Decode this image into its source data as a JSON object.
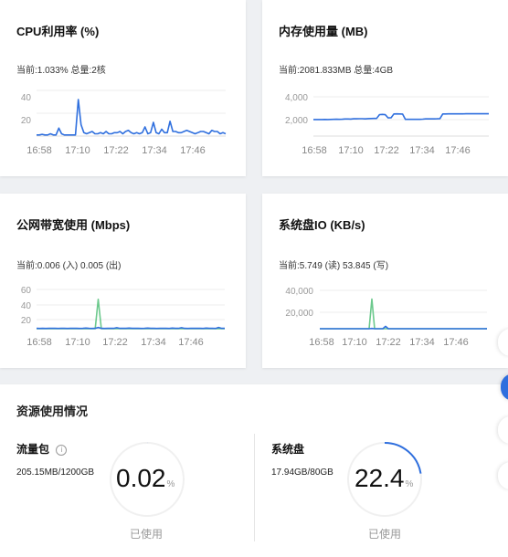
{
  "cpu": {
    "title": "CPU利用率 (%)",
    "subtitle": "当前:1.033% 总量:2核",
    "y_ticks": [
      "40",
      "20"
    ],
    "x_ticks": [
      "16:58",
      "17:10",
      "17:22",
      "17:34",
      "17:46"
    ]
  },
  "mem": {
    "title": "内存使用量 (MB)",
    "subtitle": "当前:2081.833MB 总量:4GB",
    "y_ticks": [
      "4,000",
      "2,000"
    ],
    "x_ticks": [
      "16:58",
      "17:10",
      "17:22",
      "17:34",
      "17:46"
    ]
  },
  "net": {
    "title": "公网带宽使用 (Mbps)",
    "subtitle": "当前:0.006 (入) 0.005 (出)",
    "y_ticks": [
      "60",
      "40",
      "20"
    ],
    "x_ticks": [
      "16:58",
      "17:10",
      "17:22",
      "17:34",
      "17:46"
    ]
  },
  "disk": {
    "title": "系统盘IO (KB/s)",
    "subtitle": "当前:5.749 (读) 53.845 (写)",
    "y_ticks": [
      "40,000",
      "20,000"
    ],
    "x_ticks": [
      "16:58",
      "17:10",
      "17:22",
      "17:34",
      "17:46"
    ]
  },
  "resources": {
    "title": "资源使用情况",
    "traffic": {
      "label": "流量包",
      "amount": "205.15MB/1200GB",
      "percent": "0.02",
      "unit": "%",
      "used_label": "已使用",
      "fraction": 0.0002
    },
    "disk": {
      "label": "系统盘",
      "amount": "17.94GB/80GB",
      "percent": "22.4",
      "unit": "%",
      "used_label": "已使用",
      "fraction": 0.224
    }
  },
  "colors": {
    "blue": "#2f6fde",
    "green": "#6cc98d",
    "ring_gray": "#f0f0f0"
  },
  "icons": {
    "info": "info-circle-icon"
  },
  "chart_data": [
    {
      "type": "line",
      "title": "CPU利用率 (%)",
      "x_ticks": [
        "16:58",
        "17:10",
        "17:22",
        "17:34",
        "17:46"
      ],
      "ylim": [
        0,
        45
      ],
      "series": [
        {
          "color": "#2f6fde",
          "values": [
            1,
            1,
            1.5,
            1,
            1,
            2,
            1,
            1,
            7,
            2,
            1,
            1,
            1,
            1,
            1,
            32,
            10,
            3,
            2,
            3,
            4,
            2,
            2,
            3,
            2,
            4,
            2,
            2,
            3,
            3,
            4,
            2,
            4,
            5,
            3,
            2,
            3,
            2,
            3,
            8,
            2,
            3,
            12,
            3,
            2,
            6,
            3,
            3,
            13,
            4,
            4,
            3,
            3,
            4,
            5,
            4,
            3,
            2,
            3,
            4,
            4,
            3,
            2,
            5,
            4,
            4,
            2,
            3,
            2
          ]
        }
      ]
    },
    {
      "type": "line",
      "title": "内存使用量 (MB)",
      "x_ticks": [
        "16:58",
        "17:10",
        "17:22",
        "17:34",
        "17:46"
      ],
      "ylim": [
        0,
        4500
      ],
      "series": [
        {
          "color": "#2f6fde",
          "values": [
            1680,
            1680,
            1680,
            1680,
            1690,
            1680,
            1690,
            1700,
            1710,
            1700,
            1710,
            1740,
            1740,
            1730,
            1760,
            1760,
            1770,
            1770,
            1750,
            1780,
            1790,
            1800,
            1800,
            2190,
            2200,
            2180,
            1850,
            1860,
            2250,
            2260,
            2250,
            2240,
            1700,
            1700,
            1700,
            1700,
            1700,
            1700,
            1720,
            1750,
            1750,
            1750,
            1750,
            1760,
            1780,
            2250,
            2250,
            2260,
            2260,
            2260,
            2260,
            2260,
            2260,
            2270,
            2270,
            2270,
            2270,
            2270,
            2270,
            2270,
            2270,
            2270
          ]
        }
      ]
    },
    {
      "type": "line",
      "title": "公网带宽使用 (Mbps)",
      "x_ticks": [
        "16:58",
        "17:10",
        "17:22",
        "17:34",
        "17:46"
      ],
      "ylim": [
        0,
        65
      ],
      "series": [
        {
          "color": "#6cc98d",
          "values": [
            0,
            0,
            0,
            0,
            0,
            0,
            0,
            0,
            0,
            0,
            0,
            0,
            0,
            0,
            0,
            0,
            0,
            0,
            0,
            0,
            45,
            0,
            0,
            0,
            0,
            0,
            0,
            0,
            0,
            0,
            0,
            0,
            0,
            0,
            0,
            0,
            0,
            0,
            0,
            0,
            0,
            0,
            0,
            0,
            0,
            0,
            0,
            0,
            0,
            0,
            0,
            0,
            0,
            0,
            0,
            0,
            0,
            0,
            0,
            0,
            0,
            0
          ]
        },
        {
          "color": "#2f6fde",
          "values": [
            0.5,
            0.4,
            0.5,
            0.4,
            0.5,
            0.6,
            0.5,
            0.4,
            0.5,
            0.5,
            0.4,
            0.5,
            0.6,
            0.5,
            0.4,
            0.5,
            1,
            0.5,
            0.4,
            0.5,
            2,
            0.6,
            0.4,
            0.5,
            0.6,
            0.5,
            1.5,
            0.5,
            0.6,
            0.5,
            1,
            0.5,
            0.5,
            0.6,
            0.4,
            0.5,
            1,
            0.5,
            0.5,
            0.4,
            0.5,
            0.6,
            0.5,
            0.4,
            1,
            0.5,
            0.5,
            1.5,
            0.5,
            0.4,
            0.5,
            0.6,
            0.5,
            0.5,
            0.4,
            1,
            0.5,
            0.5,
            0.4,
            2,
            0.5,
            0.6
          ]
        }
      ]
    },
    {
      "type": "line",
      "title": "系统盘IO (KB/s)",
      "x_ticks": [
        "16:58",
        "17:10",
        "17:22",
        "17:34",
        "17:46"
      ],
      "ylim": [
        0,
        45000
      ],
      "series": [
        {
          "color": "#6cc98d",
          "values": [
            0,
            0,
            0,
            0,
            0,
            0,
            0,
            0,
            0,
            0,
            0,
            0,
            0,
            0,
            0,
            0,
            0,
            0,
            0,
            31000,
            0,
            0,
            0,
            0,
            0,
            0,
            0,
            0,
            0,
            0,
            0,
            0,
            0,
            0,
            0,
            0,
            0,
            0,
            0,
            0,
            0,
            0,
            0,
            0,
            0,
            0,
            0,
            0,
            0,
            0,
            0,
            0,
            0,
            0,
            0,
            0,
            0,
            0,
            0,
            0,
            0,
            0
          ]
        },
        {
          "color": "#2f6fde",
          "values": [
            10,
            10,
            10,
            10,
            10,
            10,
            10,
            10,
            10,
            10,
            10,
            10,
            10,
            10,
            10,
            10,
            10,
            10,
            10,
            300,
            10,
            10,
            10,
            10,
            2500,
            10,
            10,
            10,
            10,
            10,
            10,
            10,
            10,
            10,
            10,
            10,
            10,
            10,
            10,
            10,
            10,
            10,
            10,
            10,
            10,
            10,
            10,
            10,
            10,
            10,
            10,
            10,
            10,
            10,
            10,
            10,
            10,
            10,
            10,
            10,
            10,
            50
          ]
        }
      ]
    }
  ]
}
